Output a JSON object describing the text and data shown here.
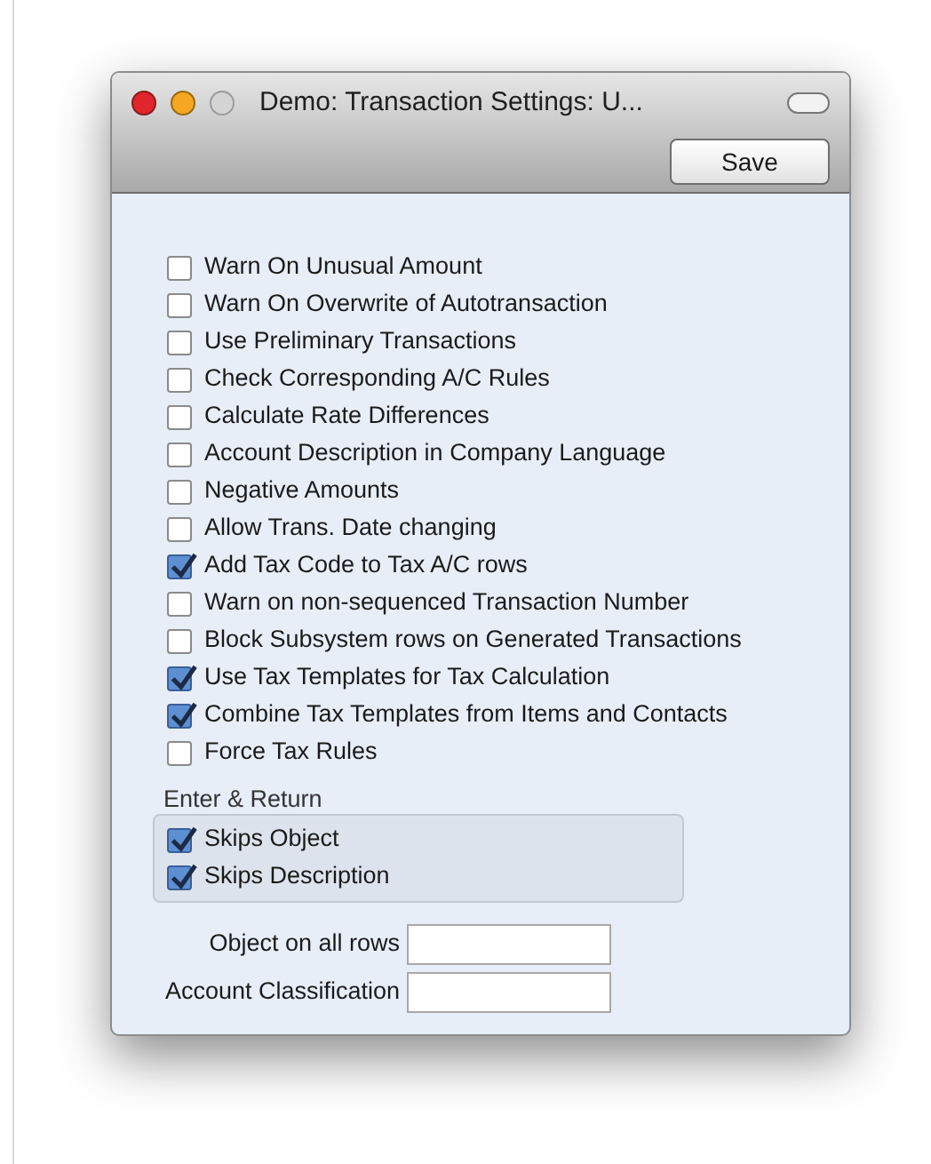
{
  "window": {
    "title": "Demo: Transaction Settings: U..."
  },
  "toolbar": {
    "buttons": [
      "Save"
    ]
  },
  "options": [
    {
      "label": "Warn On Unusual Amount",
      "checked": false
    },
    {
      "label": "Warn On Overwrite of Autotransaction",
      "checked": false
    },
    {
      "label": "Use Preliminary Transactions",
      "checked": false
    },
    {
      "label": "Check Corresponding A/C Rules",
      "checked": false
    },
    {
      "label": "Calculate Rate Differences",
      "checked": false
    },
    {
      "label": "Account Description in Company Language",
      "checked": false
    },
    {
      "label": "Negative Amounts",
      "checked": false
    },
    {
      "label": "Allow Trans. Date changing",
      "checked": false
    },
    {
      "label": "Add Tax Code to Tax A/C rows",
      "checked": true
    },
    {
      "label": "Warn on non-sequenced Transaction Number",
      "checked": false
    },
    {
      "label": "Block Subsystem rows on Generated Transactions",
      "checked": false
    },
    {
      "label": "Use Tax Templates for Tax Calculation",
      "checked": true
    },
    {
      "label": "Combine Tax Templates from Items and Contacts",
      "checked": true
    },
    {
      "label": "Force Tax Rules",
      "checked": false
    }
  ],
  "enter_return": {
    "title": "Enter & Return",
    "options": [
      {
        "label": "Skips Object",
        "checked": true
      },
      {
        "label": "Skips Description",
        "checked": true
      }
    ]
  },
  "fields": [
    {
      "label": "Object on all rows"
    },
    {
      "label": "Account Classification"
    }
  ]
}
